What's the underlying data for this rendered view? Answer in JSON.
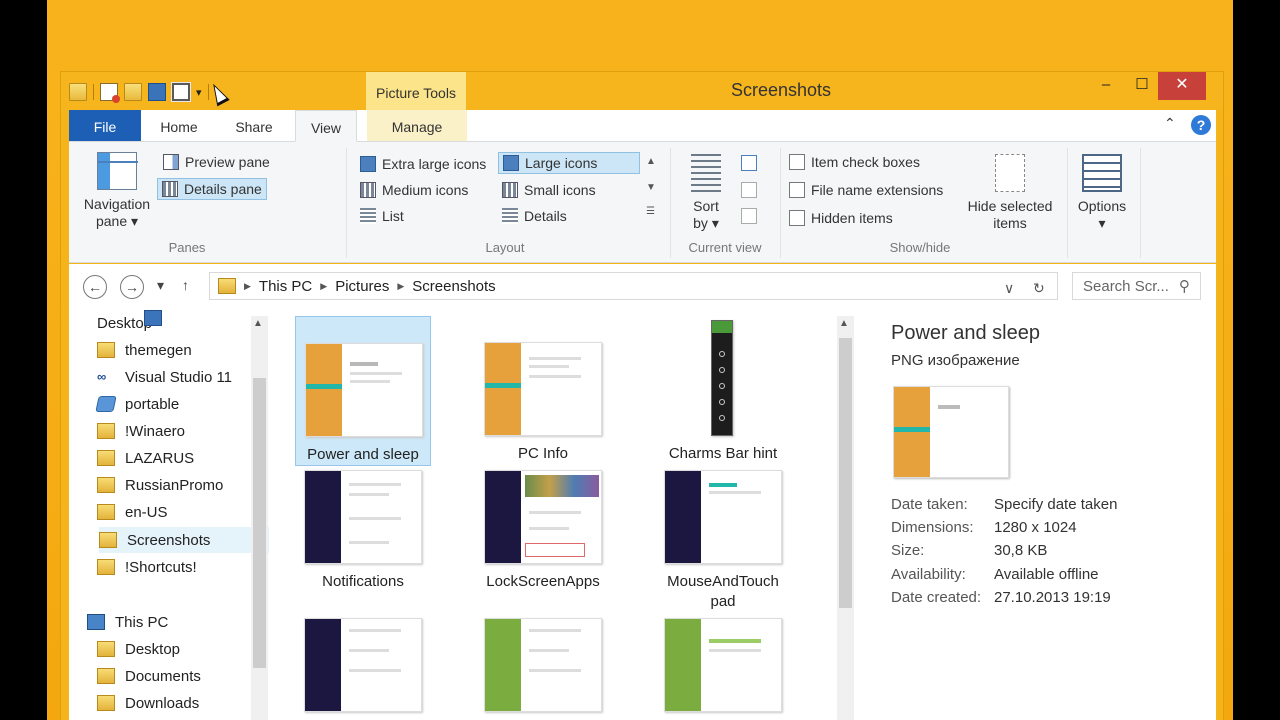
{
  "window": {
    "title": "Screenshots",
    "context_tab_group": "Picture Tools",
    "minimize_glyph": "‒",
    "maximize_glyph": "☐",
    "close_glyph": "✕"
  },
  "ribbon_tabs": {
    "file": "File",
    "home": "Home",
    "share": "Share",
    "view": "View",
    "manage": "Manage",
    "help_glyph": "?",
    "collapse_glyph": "⌃"
  },
  "ribbon": {
    "panes": {
      "navigation_pane": "Navigation pane",
      "navigation_pane_line1": "Navigation",
      "navigation_pane_line2": "pane ▾",
      "preview_pane": "Preview pane",
      "details_pane": "Details pane",
      "label": "Panes"
    },
    "layout": {
      "extra_large_icons": "Extra large icons",
      "large_icons": "Large icons",
      "medium_icons": "Medium icons",
      "small_icons": "Small icons",
      "list": "List",
      "details": "Details",
      "label": "Layout"
    },
    "current_view": {
      "sort_by_line1": "Sort",
      "sort_by_line2": "by ▾",
      "label": "Current view"
    },
    "show_hide": {
      "item_check_boxes": "Item check boxes",
      "file_name_extensions": "File name extensions",
      "hidden_items": "Hidden items",
      "hide_selected_line1": "Hide selected",
      "hide_selected_line2": "items",
      "label": "Show/hide"
    },
    "options": {
      "label": "Options",
      "arrow": "▾"
    }
  },
  "address_bar": {
    "back_glyph": "←",
    "forward_glyph": "→",
    "recent_glyph": "▾",
    "up_glyph": "↑",
    "crumbs": [
      "This PC",
      "Pictures",
      "Screenshots"
    ],
    "dropdown_glyph": "∨",
    "refresh_glyph": "↻",
    "search_placeholder": "Search Scr...",
    "search_glyph": "⚲"
  },
  "nav_pane": {
    "quick_items": [
      {
        "label": "Desktop",
        "icon": "desktop-icon"
      },
      {
        "label": "themegen",
        "icon": "folder-icon"
      },
      {
        "label": "Visual Studio 11",
        "icon": "visual-studio-icon"
      },
      {
        "label": "portable",
        "icon": "drive-icon"
      },
      {
        "label": "!Winaero",
        "icon": "folder-icon"
      },
      {
        "label": "LAZARUS",
        "icon": "folder-icon"
      },
      {
        "label": "RussianPromo",
        "icon": "folder-icon"
      },
      {
        "label": "en-US",
        "icon": "folder-icon"
      },
      {
        "label": "Screenshots",
        "icon": "folder-icon",
        "selected": true
      },
      {
        "label": "!Shortcuts!",
        "icon": "folder-icon"
      }
    ],
    "this_pc": "This PC",
    "pc_items": [
      {
        "label": "Desktop",
        "icon": "folder-icon"
      },
      {
        "label": "Documents",
        "icon": "folder-icon"
      },
      {
        "label": "Downloads",
        "icon": "folder-icon"
      }
    ]
  },
  "files": [
    {
      "name": "Power and sleep",
      "selected": true,
      "theme": "orange"
    },
    {
      "name": "PC Info",
      "theme": "orange"
    },
    {
      "name": "Charms Bar hint",
      "theme": "charms"
    },
    {
      "name": "Notifications",
      "theme": "dark"
    },
    {
      "name": "LockScreenApps",
      "theme": "dark"
    },
    {
      "name": "MouseAndTouch pad",
      "theme": "dark"
    },
    {
      "name": "",
      "theme": "dark"
    },
    {
      "name": "",
      "theme": "green"
    },
    {
      "name": "",
      "theme": "green"
    }
  ],
  "details_pane": {
    "title": "Power and sleep",
    "type": "PNG изображение",
    "rows": [
      {
        "key": "Date taken:",
        "value": "Specify date taken"
      },
      {
        "key": "Dimensions:",
        "value": "1280 x 1024"
      },
      {
        "key": "Size:",
        "value": "30,8 KB"
      },
      {
        "key": "Availability:",
        "value": "Available offline"
      },
      {
        "key": "Date created:",
        "value": "27.10.2013 19:19"
      }
    ]
  },
  "colors": {
    "desktop_accent": "#f8b21a",
    "file_tab": "#1c5fb4",
    "close_button": "#c7413a",
    "orange_theme": "#e6a03c",
    "dark_theme": "#1b1740",
    "green_theme": "#7aac3f",
    "teal_bar": "#22b7a8"
  }
}
